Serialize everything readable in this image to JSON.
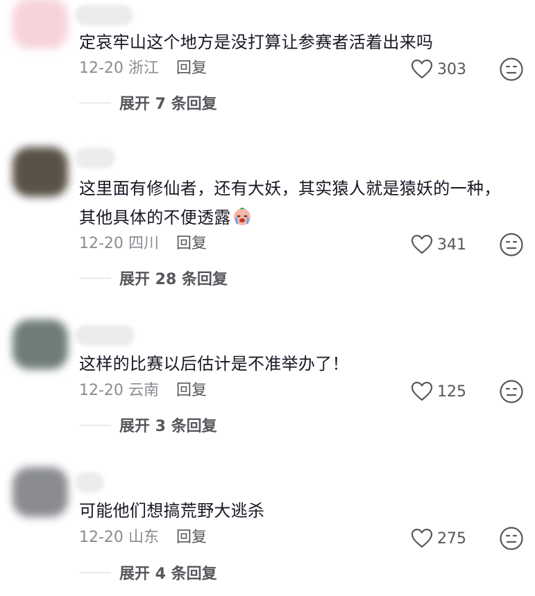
{
  "comments": [
    {
      "text": "定哀牢山这个地方是没打算让参赛者活着出来吗",
      "date": "12-20",
      "location": "浙江",
      "reply_label": "回复",
      "likes": "303",
      "expand_label": "展开 7 条回复",
      "avatar_color": "#f6d3da"
    },
    {
      "text": "这里面有修仙者，还有大妖，其实猿人就是猿妖的一种，其他具体的不便透露",
      "emoji": "crying-face-emoji",
      "date": "12-20",
      "location": "四川",
      "reply_label": "回复",
      "likes": "341",
      "expand_label": "展开 28 条回复",
      "avatar_color": "#5a5248"
    },
    {
      "text": "这样的比赛以后估计是不准举办了！",
      "date": "12-20",
      "location": "云南",
      "reply_label": "回复",
      "likes": "125",
      "expand_label": "展开 3 条回复",
      "avatar_color": "#6f7d78"
    },
    {
      "text": "可能他们想搞荒野大逃杀",
      "date": "12-20",
      "location": "山东",
      "reply_label": "回复",
      "likes": "275",
      "expand_label": "展开 4 条回复",
      "avatar_color": "#8a8c92"
    }
  ],
  "icons": {
    "like": "heart-outline-icon",
    "reaction": "neutral-face-icon"
  }
}
